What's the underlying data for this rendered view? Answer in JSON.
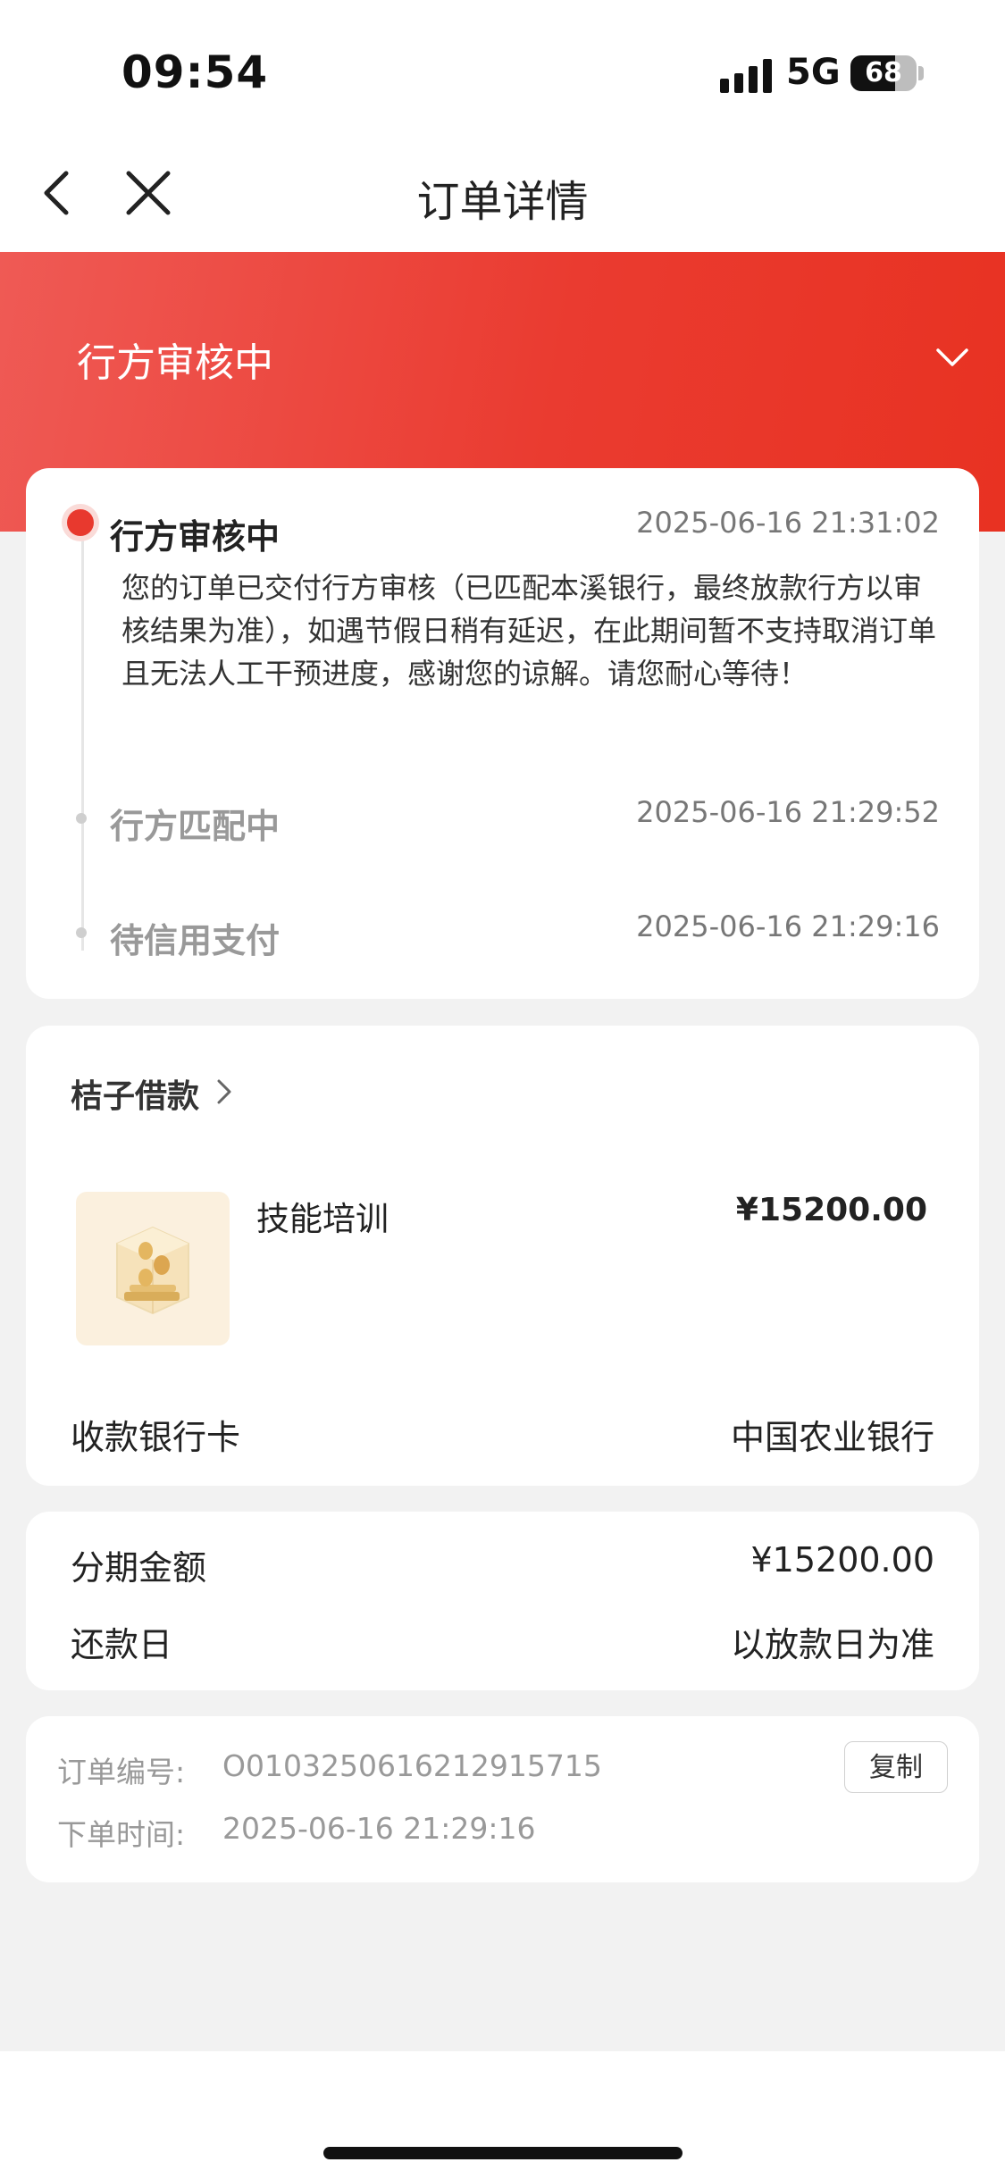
{
  "status_bar": {
    "time": "09:54",
    "network": "5G",
    "battery": "68",
    "battery_level": 0.68
  },
  "nav": {
    "title": "订单详情",
    "back_icon": "chevron-left-icon",
    "close_icon": "close-icon"
  },
  "banner": {
    "status": "行方审核中",
    "toggle_icon": "chevron-down-icon"
  },
  "timeline": [
    {
      "title": "行方审核中",
      "time": "2025-06-16 21:31:02",
      "desc": "您的订单已交付行方审核（已匹配本溪银行，最终放款行方以审核结果为准），如遇节假日稍有延迟，在此期间暂不支持取消订单且无法人工干预进度，感谢您的谅解。请您耐心等待！",
      "active": true
    },
    {
      "title": "行方匹配中",
      "time": "2025-06-16 21:29:52",
      "active": false
    },
    {
      "title": "待信用支付",
      "time": "2025-06-16 21:29:16",
      "active": false
    }
  ],
  "product": {
    "merchant": "桔子借款",
    "name": "技能培训",
    "price": "¥15200.00",
    "bank_label": "收款银行卡",
    "bank_value": "中国农业银行"
  },
  "installment": {
    "amount_label": "分期金额",
    "amount_value": "¥15200.00",
    "repay_label": "还款日",
    "repay_value": "以放款日为准"
  },
  "order_info": {
    "number_label": "订单编号:",
    "number_value": "O0103250616212915715",
    "copy_label": "复制",
    "time_label": "下单时间:",
    "time_value": "2025-06-16 21:29:16"
  },
  "colors": {
    "accent": "#e8392e",
    "banner_start": "#ef5a55",
    "banner_end": "#e83222",
    "background": "#f2f2f2"
  }
}
